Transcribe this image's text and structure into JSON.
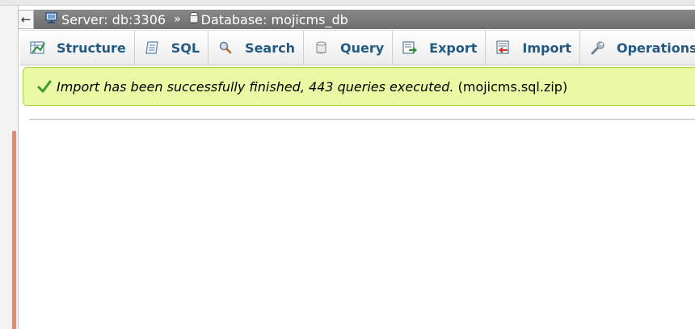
{
  "nav": {
    "back_glyph": "←"
  },
  "breadcrumb": {
    "server_label": "Server: db:3306",
    "separator": "»",
    "database_label": "Database: mojicms_db"
  },
  "tabs": [
    {
      "label": "Structure",
      "icon": "structure-icon"
    },
    {
      "label": "SQL",
      "icon": "sql-icon"
    },
    {
      "label": "Search",
      "icon": "search-icon"
    },
    {
      "label": "Query",
      "icon": "query-icon"
    },
    {
      "label": "Export",
      "icon": "export-icon"
    },
    {
      "label": "Import",
      "icon": "import-icon"
    },
    {
      "label": "Operations",
      "icon": "operations-icon"
    }
  ],
  "message": {
    "text": "Import has been successfully finished, 443 queries executed.",
    "file": "(mojicms.sql.zip)"
  },
  "colors": {
    "breadcrumb_bg": "#7a7a7a",
    "tab_text": "#235a81",
    "success_bg": "#ebf8a4",
    "success_border": "#a2d246",
    "accent": "#e9876a"
  }
}
